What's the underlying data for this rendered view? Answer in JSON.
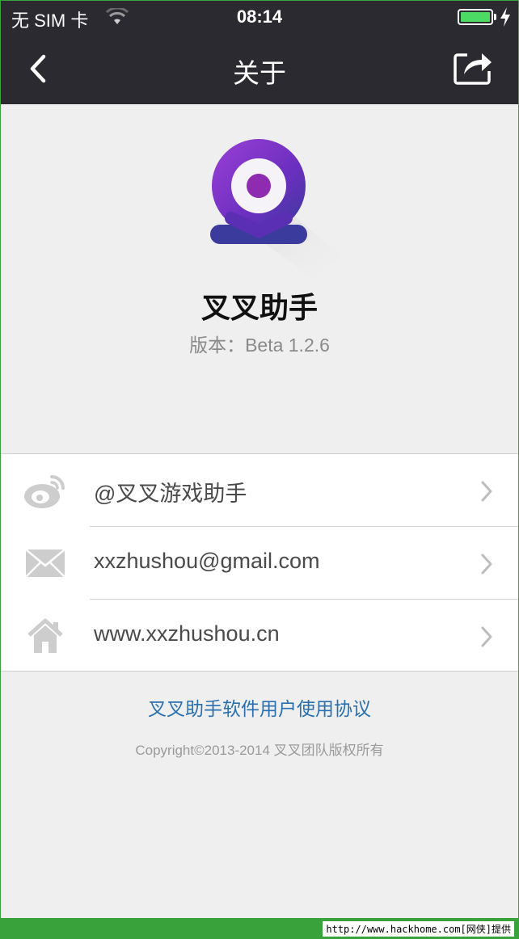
{
  "status_bar": {
    "carrier": "无 SIM 卡",
    "time": "08:14",
    "battery_level": 1.0,
    "battery_color": "#4cd964"
  },
  "nav": {
    "back_icon": "chevron-left-icon",
    "title": "关于",
    "share_icon": "share-icon"
  },
  "app": {
    "name": "叉叉助手",
    "version": "版本：Beta 1.2.6",
    "logo_colors": [
      "#8a2be2",
      "#5b2fb4",
      "#2f3a93"
    ]
  },
  "list": {
    "items": [
      {
        "icon": "weibo-icon",
        "label": "@叉叉游戏助手"
      },
      {
        "icon": "mail-icon",
        "label": "xxzhushou@gmail.com"
      },
      {
        "icon": "home-icon",
        "label": "www.xxzhushou.cn"
      }
    ]
  },
  "footer": {
    "agreement_link": "叉叉助手软件用户使用协议",
    "copyright": "Copyright©2013-2014 叉叉团队版权所有",
    "watermark": "http://www.hackhome.com[网侠]提供",
    "link_color": "#2a6fb0"
  }
}
